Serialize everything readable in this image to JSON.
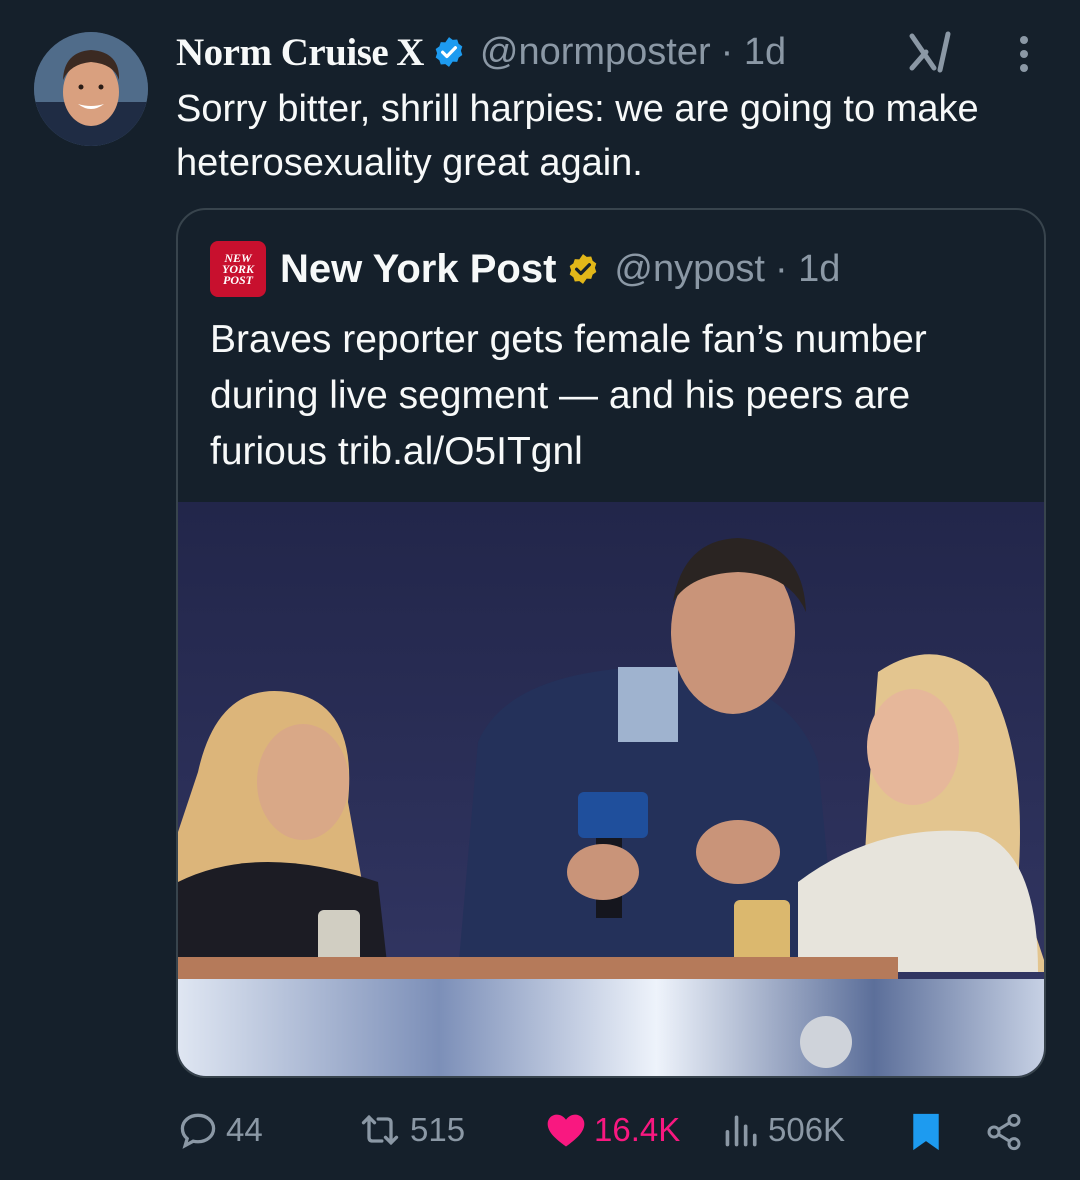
{
  "author": {
    "display_name": "Norm Cruise",
    "x_badge": "X",
    "handle": "@normposter",
    "time": "· 1d",
    "avatar": "avatar-photo",
    "verified_color": "#1d9bf0"
  },
  "tweet": {
    "text": "Sorry bitter, shrill harpies: we are going to make heterosexuality great again."
  },
  "quote": {
    "logo_lines": [
      "NEW",
      "YORK",
      "POST"
    ],
    "name": "New York Post",
    "handle": "@nypost",
    "time": "· 1d",
    "verified_color": "#e2b719",
    "text": "Braves reporter gets female fan’s number during live segment — and his peers are furious trib.al/O5ITgnl",
    "image": "stadium-suite-photo"
  },
  "actions": {
    "replies": "44",
    "reposts": "515",
    "likes": "16.4K",
    "views": "506K",
    "like_color": "#f91880",
    "bookmark_color": "#1d9bf0",
    "icons": [
      "reply-icon",
      "repost-icon",
      "heart-icon",
      "views-icon",
      "bookmark-icon",
      "share-icon"
    ]
  },
  "toolbar": {
    "icons": [
      "grok-icon",
      "more-icon"
    ]
  }
}
